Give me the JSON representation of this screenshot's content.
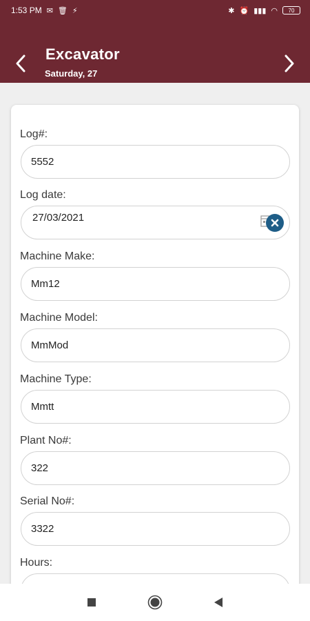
{
  "status_bar": {
    "time": "1:53 PM",
    "battery": "70"
  },
  "header": {
    "title": "Excavator",
    "subtitle": "Saturday, 27"
  },
  "form": {
    "fields": [
      {
        "label": "Log#:",
        "value": "5552"
      },
      {
        "label": "Log date:",
        "value": "27/03/2021"
      },
      {
        "label": "Machine Make:",
        "value": "Mm12"
      },
      {
        "label": "Machine Model:",
        "value": "MmMod"
      },
      {
        "label": "Machine Type:",
        "value": "Mmtt"
      },
      {
        "label": "Plant No#:",
        "value": "322"
      },
      {
        "label": "Serial No#:",
        "value": "3322"
      },
      {
        "label": "Hours:",
        "value": ""
      }
    ]
  },
  "colors": {
    "primary": "#6e2832",
    "accent": "#1e5d87"
  },
  "icons": {
    "prev": "chevron-left-icon",
    "next": "chevron-right-icon",
    "clear": "close-circle-icon",
    "calendar": "calendar-icon"
  }
}
